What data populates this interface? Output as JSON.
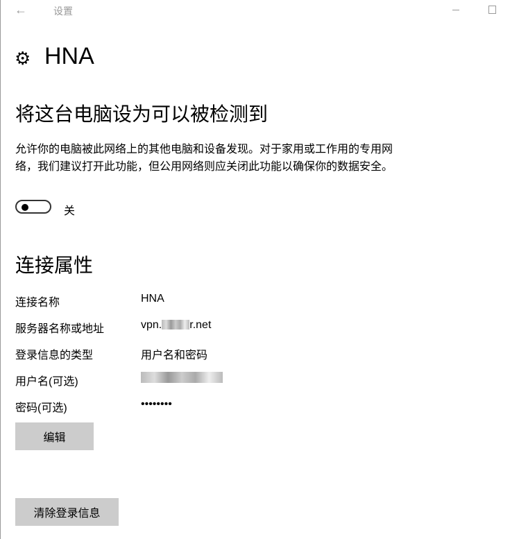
{
  "titlebar": {
    "title": "设置",
    "back_icon": "arrow-left-icon"
  },
  "page": {
    "title": "HNA",
    "icon": "gear-icon"
  },
  "discover": {
    "heading": "将这台电脑设为可以被检测到",
    "description": "允许你的电脑被此网络上的其他电脑和设备发现。对于家用或工作用的专用网络，我们建议打开此功能，但公用网络则应关闭此功能以确保你的数据安全。",
    "toggle_on": false,
    "toggle_label": "关"
  },
  "props": {
    "heading": "连接属性",
    "rows": [
      {
        "label": "连接名称",
        "value": "HNA"
      },
      {
        "label": "服务器名称或地址",
        "value_prefix": "vpn.",
        "value_suffix": "r.net"
      },
      {
        "label": "登录信息的类型",
        "value": "用户名和密码"
      },
      {
        "label": "用户名(可选)"
      },
      {
        "label": "密码(可选)",
        "value": "••••••••"
      }
    ]
  },
  "buttons": {
    "edit": "编辑",
    "clear": "清除登录信息"
  }
}
